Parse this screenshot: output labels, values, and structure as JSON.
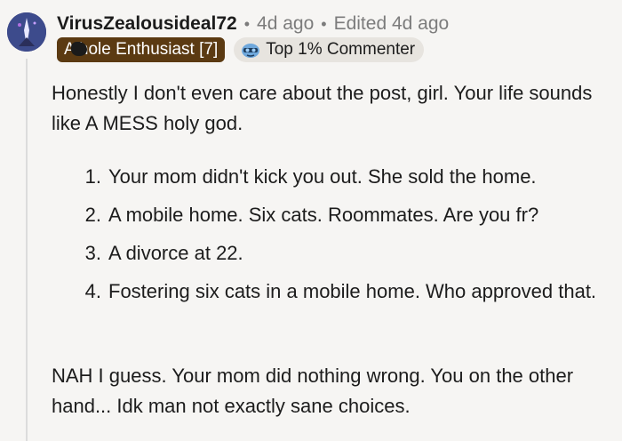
{
  "comment": {
    "username": "VirusZealousideal72",
    "posted": "4d ago",
    "edited": "Edited 4d ago",
    "separator": "•",
    "flair": "A  hole Enthusiast [7]",
    "badge": {
      "label": "Top 1% Commenter",
      "icon": "commenter-badge-icon"
    },
    "paragraphs": [
      "Honestly I don't even care about the post, girl. Your life sounds like A MESS holy god.",
      "NAH I guess. Your mom did nothing wrong. You on the other hand... Idk man not exactly sane choices."
    ],
    "list": [
      {
        "num": "1.",
        "text": "Your mom didn't kick you out. She sold the home."
      },
      {
        "num": "2.",
        "text": "A mobile home. Six cats. Roommates. Are you fr?"
      },
      {
        "num": "3.",
        "text": "A divorce at 22."
      },
      {
        "num": "4.",
        "text": "Fostering six cats in a mobile home. Who approved that."
      }
    ]
  },
  "colors": {
    "background": "#f6f5f3",
    "flair_bg": "#5b3a12",
    "badge_bg": "#e7e4df",
    "meta_text": "#7c7c7c"
  }
}
